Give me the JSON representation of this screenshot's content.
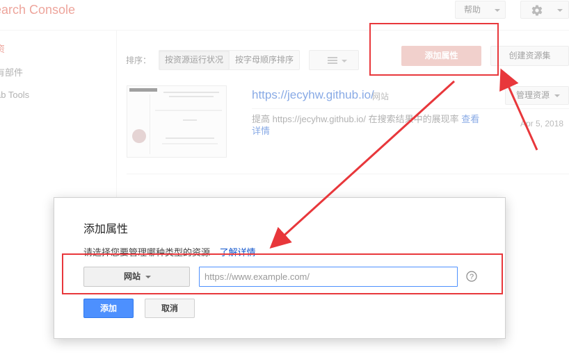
{
  "header": {
    "brand": "earch Console",
    "help_label": "帮助"
  },
  "sidebar": {
    "items": [
      {
        "label": "资"
      },
      {
        "label": "有部件"
      },
      {
        "label": "ab Tools"
      }
    ]
  },
  "toolbar": {
    "sort_label": "排序：",
    "sort_by_status": "按资源运行状况",
    "sort_by_alpha": "按字母顺序排序",
    "add_property": "添加属性",
    "create_set": "创建资源集"
  },
  "property": {
    "url": "https://jecyhw.github.io/",
    "type": "网站",
    "manage_label": "管理资源",
    "improve_text": "提高 https://jecyhw.github.io/ 在搜索结果中的展现率",
    "details_link": "查看详情",
    "date": "Apr 5, 2018"
  },
  "dialog": {
    "title": "添加属性",
    "description": "请选择您要管理哪种类型的资源",
    "learn_more": "了解详情",
    "type_value": "网站",
    "url_placeholder": "https://www.example.com/",
    "add_label": "添加",
    "cancel_label": "取消"
  },
  "colors": {
    "brand_red": "#dd4b39",
    "primary_blue": "#4d90fe",
    "link_blue": "#1155cc",
    "annotation_red": "#e8373b"
  }
}
